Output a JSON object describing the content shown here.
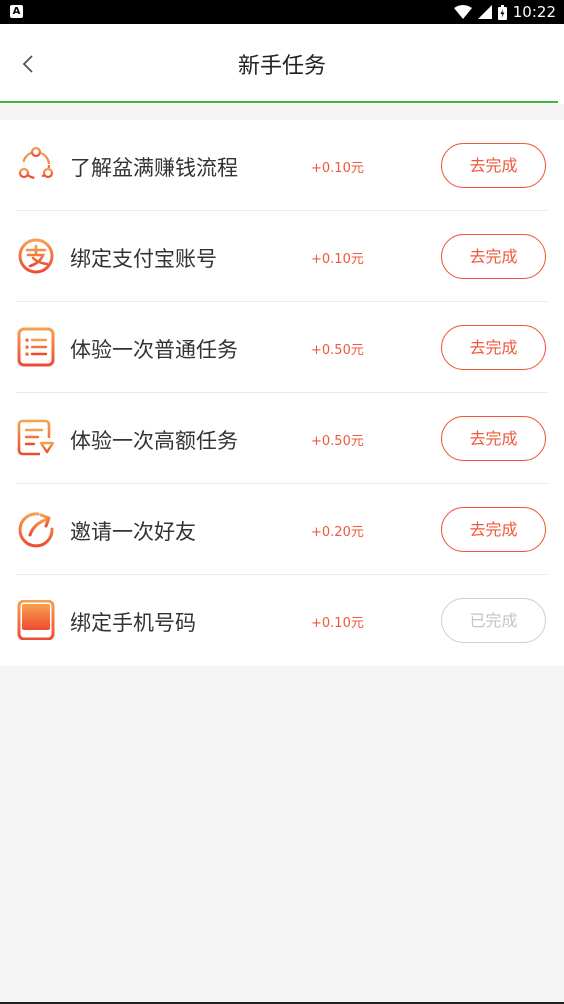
{
  "status_bar": {
    "left_badge": "A",
    "time": "10:22"
  },
  "header": {
    "title": "新手任务",
    "back_icon": "chevron-left-icon"
  },
  "colors": {
    "accent": "#f0583b",
    "divider_green": "#3cb93c",
    "done_gray": "#c4c4c4"
  },
  "tasks": [
    {
      "title": "了解盆满赚钱流程",
      "reward": "+0.10元",
      "button": "去完成",
      "done": false,
      "icon": "share-nodes-icon"
    },
    {
      "title": "绑定支付宝账号",
      "reward": "+0.10元",
      "button": "去完成",
      "done": false,
      "icon": "alipay-icon"
    },
    {
      "title": "体验一次普通任务",
      "reward": "+0.50元",
      "button": "去完成",
      "done": false,
      "icon": "list-icon"
    },
    {
      "title": "体验一次高额任务",
      "reward": "+0.50元",
      "button": "去完成",
      "done": false,
      "icon": "list-diamond-icon"
    },
    {
      "title": "邀请一次好友",
      "reward": "+0.20元",
      "button": "去完成",
      "done": false,
      "icon": "share-arrow-icon"
    },
    {
      "title": "绑定手机号码",
      "reward": "+0.10元",
      "button": "已完成",
      "done": true,
      "icon": "phone-icon"
    }
  ]
}
